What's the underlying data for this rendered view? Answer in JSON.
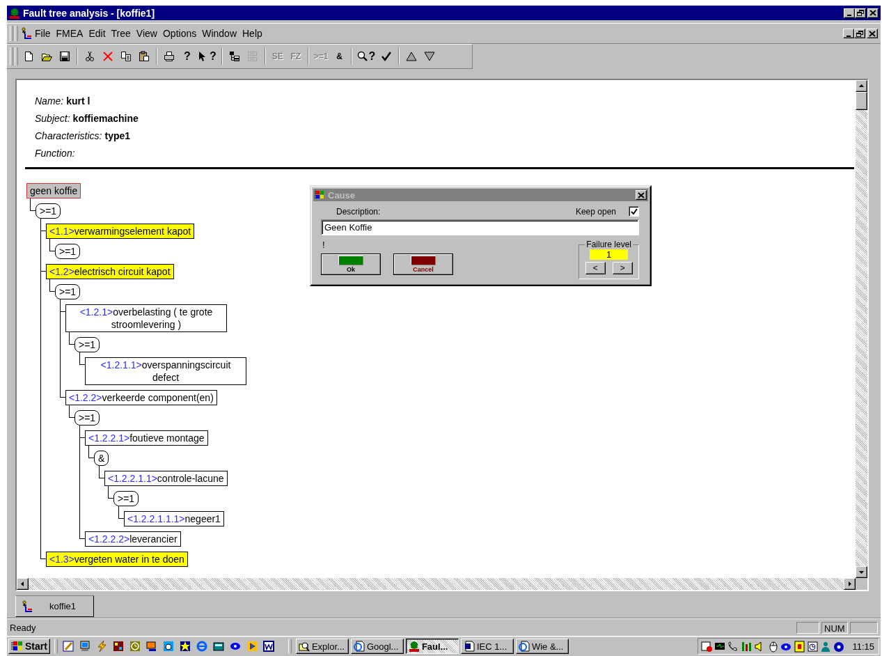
{
  "window": {
    "title": "Fault tree analysis - [koffie1]"
  },
  "menu": [
    "File",
    "FMEA",
    "Edit",
    "Tree",
    "View",
    "Options",
    "Window",
    "Help"
  ],
  "toolbar": [
    [
      {
        "kind": "new",
        "disabled": false
      },
      {
        "kind": "open",
        "disabled": false
      },
      {
        "kind": "save",
        "disabled": false
      }
    ],
    [
      {
        "kind": "cut",
        "disabled": false
      },
      {
        "kind": "delete",
        "disabled": false
      },
      {
        "kind": "copy",
        "disabled": false
      },
      {
        "kind": "paste",
        "disabled": false
      }
    ],
    [
      {
        "kind": "print",
        "disabled": false
      },
      {
        "kind": "help",
        "label": "?",
        "disabled": false
      },
      {
        "kind": "context-help",
        "label": "?",
        "disabled": false
      }
    ],
    [
      {
        "kind": "tree-add",
        "disabled": false
      },
      {
        "kind": "tree-remove",
        "disabled": true
      }
    ],
    [
      {
        "kind": "text",
        "label": "SE",
        "disabled": true
      },
      {
        "kind": "text",
        "label": "FZ",
        "disabled": true
      }
    ],
    [
      {
        "kind": "text",
        "label": ">=1",
        "disabled": true
      },
      {
        "kind": "text",
        "label": "&",
        "disabled": false
      }
    ],
    [
      {
        "kind": "find",
        "label": "?",
        "disabled": false
      },
      {
        "kind": "check",
        "disabled": false
      }
    ],
    [
      {
        "kind": "up",
        "disabled": false
      },
      {
        "kind": "down",
        "disabled": false
      }
    ]
  ],
  "document": {
    "fields": [
      {
        "label": "Name:",
        "value": "kurt l"
      },
      {
        "label": "Subject:",
        "value": "koffiemachine"
      },
      {
        "label": "Characteristics:",
        "value": "type1"
      },
      {
        "label": "Function:"
      }
    ],
    "tree": {
      "text": "geen koffie",
      "selected": true,
      "highlighted": false,
      "gate": {
        "label": ">=1",
        "children": [
          {
            "number": "<1.1>",
            "text": "verwarmingselement kapot",
            "selected": false,
            "highlighted": true,
            "gate": {
              "label": ">=1"
            }
          },
          {
            "number": "<1.2>",
            "text": "electrisch circuit kapot",
            "selected": false,
            "highlighted": true,
            "gate": {
              "label": ">=1",
              "children": [
                {
                  "number": "<1.2.1>",
                  "text": "overbelasting ( te grote stroomlevering )",
                  "selected": false,
                  "highlighted": false,
                  "gate": {
                    "label": ">=1",
                    "children": [
                      {
                        "number": "<1.2.1.1>",
                        "text": "overspanningscircuit defect",
                        "selected": false,
                        "highlighted": false
                      }
                    ]
                  }
                },
                {
                  "number": "<1.2.2>",
                  "text": "verkeerde component(en)",
                  "selected": false,
                  "highlighted": false,
                  "gate": {
                    "label": ">=1",
                    "children": [
                      {
                        "number": "<1.2.2.1>",
                        "text": "foutieve montage",
                        "selected": false,
                        "highlighted": false,
                        "gate": {
                          "label": "&",
                          "children": [
                            {
                              "number": "<1.2.2.1.1>",
                              "text": "controle-lacune",
                              "selected": false,
                              "highlighted": false,
                              "gate": {
                                "label": ">=1",
                                "children": [
                                  {
                                    "number": "<1.2.2.1.1.1>",
                                    "text": "negeer1",
                                    "selected": false,
                                    "highlighted": false
                                  }
                                ]
                              }
                            }
                          ]
                        }
                      },
                      {
                        "number": "<1.2.2.2>",
                        "text": "leverancier",
                        "selected": false,
                        "highlighted": false
                      }
                    ]
                  }
                }
              ]
            }
          },
          {
            "number": "<1.3>",
            "text": "vergeten water in te doen",
            "selected": false,
            "highlighted": true
          }
        ]
      }
    }
  },
  "dialog": {
    "title": "Cause",
    "description_label": "Description:",
    "keep_open_label": "Keep open",
    "keep_open": true,
    "description": "Geen Koffie",
    "message": "!",
    "ok": "Ok",
    "cancel": "Cancel",
    "failure_level_label": "Failure level",
    "failure_level": "1",
    "prev": "<",
    "next": ">"
  },
  "tabs": [
    {
      "label": "koffie1",
      "selected": true
    }
  ],
  "status_bar": {
    "text": "Ready",
    "indicator": "NUM"
  },
  "taskbar": {
    "start": "Start",
    "tasks": [
      {
        "label": "Explor...",
        "selected": false
      },
      {
        "label": "Googl...",
        "selected": false
      },
      {
        "label": "Faul...",
        "selected": true
      },
      {
        "label": "IEC 1...",
        "selected": false
      },
      {
        "label": "Wie &...",
        "selected": false
      }
    ],
    "clock": "11:15"
  }
}
